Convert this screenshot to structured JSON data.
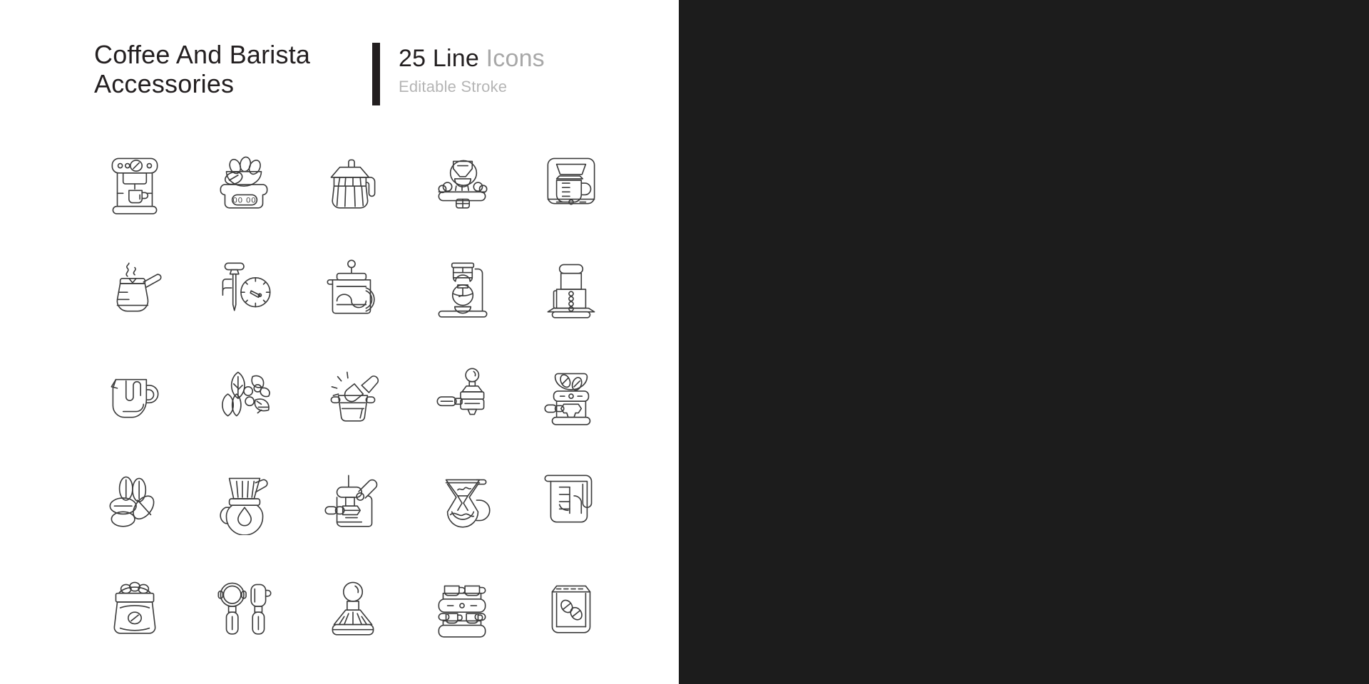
{
  "header": {
    "title_line1": "Coffee And Barista",
    "title_line2": "Accessories",
    "count_strong": "25 Line",
    "count_soft": "Icons",
    "stroke_note": "Editable Stroke"
  },
  "colors": {
    "light_background": "#ffffff",
    "dark_background": "#1c1c1c",
    "light_stroke": "#3c3c3c",
    "dark_stroke": "#f2f2f2",
    "title_text": "#231f20",
    "muted_text": "#b5b5b5"
  },
  "layout": {
    "rows": 5,
    "columns": 5,
    "total_icons": 25,
    "themes": [
      "light",
      "dark"
    ]
  },
  "icons": [
    {
      "id": "espresso-machine",
      "label": "Espresso machine",
      "row": 1,
      "col": 1
    },
    {
      "id": "coffee-scale",
      "label": "Coffee scale with beans",
      "row": 1,
      "col": 2,
      "display": "00 00"
    },
    {
      "id": "moka-pot",
      "label": "Moka pot",
      "row": 1,
      "col": 3
    },
    {
      "id": "coffee-roaster",
      "label": "Coffee roaster",
      "row": 1,
      "col": 4
    },
    {
      "id": "drip-coffee-maker",
      "label": "Drip coffee maker",
      "row": 1,
      "col": 5
    },
    {
      "id": "turkish-cezve",
      "label": "Turkish coffee pot",
      "row": 2,
      "col": 1
    },
    {
      "id": "coffee-thermometer",
      "label": "Coffee thermometer",
      "row": 2,
      "col": 2
    },
    {
      "id": "french-press",
      "label": "French press",
      "row": 2,
      "col": 3
    },
    {
      "id": "siphon-brewer",
      "label": "Siphon coffee brewer",
      "row": 2,
      "col": 4
    },
    {
      "id": "aeropress",
      "label": "AeroPress",
      "row": 2,
      "col": 5
    },
    {
      "id": "milk-pitcher",
      "label": "Milk frothing pitcher",
      "row": 3,
      "col": 1
    },
    {
      "id": "coffee-plant",
      "label": "Coffee plant branch",
      "row": 3,
      "col": 2
    },
    {
      "id": "distribution-tool",
      "label": "Coffee distribution tool",
      "row": 3,
      "col": 3
    },
    {
      "id": "portafilter-tamper",
      "label": "Portafilter and tamper",
      "row": 3,
      "col": 4
    },
    {
      "id": "coffee-grinder",
      "label": "Coffee grinder",
      "row": 3,
      "col": 5
    },
    {
      "id": "coffee-beans",
      "label": "Coffee beans",
      "row": 4,
      "col": 1
    },
    {
      "id": "pour-over-dripper",
      "label": "Pour over dripper",
      "row": 4,
      "col": 2
    },
    {
      "id": "lever-espresso",
      "label": "Lever espresso machine",
      "row": 4,
      "col": 3
    },
    {
      "id": "chemex-brewer",
      "label": "Chemex brewer",
      "row": 4,
      "col": 4
    },
    {
      "id": "measuring-cup",
      "label": "Measuring cup",
      "row": 4,
      "col": 5
    },
    {
      "id": "coffee-sack",
      "label": "Coffee bean sack",
      "row": 5,
      "col": 1
    },
    {
      "id": "portafilter-baskets",
      "label": "Portafilter baskets",
      "row": 5,
      "col": 2
    },
    {
      "id": "coffee-tamper",
      "label": "Coffee tamper",
      "row": 5,
      "col": 3
    },
    {
      "id": "cup-warmer-rack",
      "label": "Cup warmer rack",
      "row": 5,
      "col": 4
    },
    {
      "id": "coffee-bag",
      "label": "Coffee bag",
      "row": 5,
      "col": 5
    }
  ]
}
